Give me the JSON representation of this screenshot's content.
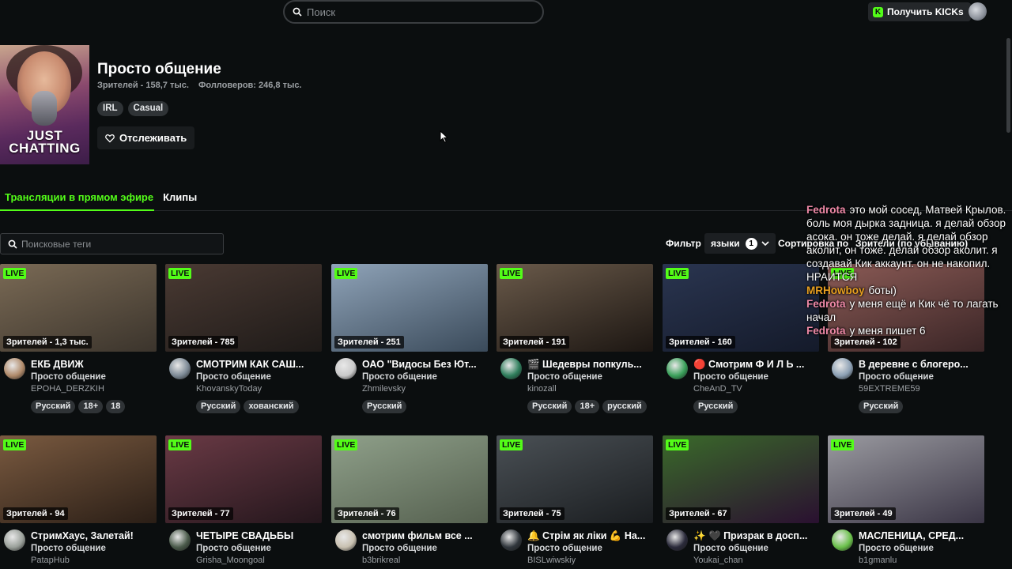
{
  "header": {
    "search_placeholder": "Поиск",
    "kicks_label": "Получить KICKs",
    "kicks_icon_glyph": "K",
    "accent": "#53fc18"
  },
  "category": {
    "cover_text": "JUST CHATTING",
    "title": "Просто общение",
    "viewers": "Зрителей - 158,7 тыс.",
    "followers": "Фолловеров: 246,8 тыс.",
    "tags": [
      "IRL",
      "Casual"
    ],
    "follow_label": "Отслеживать"
  },
  "tabs": {
    "live": "Трансляции в прямом эфире",
    "clips": "Клипы"
  },
  "filters": {
    "tag_search_placeholder": "Поисковые теги",
    "filter_label": "Фильтр",
    "language_label": "языки",
    "language_count": "1",
    "sort_label": "Сортировка по",
    "sort_value": "Зрители (по убыванию)"
  },
  "live_badge": "LIVE",
  "streams": [
    {
      "viewers": "Зрителей - 1,3 тыс.",
      "title": "ЕКБ ДВИЖ",
      "category": "Просто общение",
      "user": "EPOHA_DERZKIH",
      "tags": [
        "Русский",
        "18+",
        "18"
      ],
      "thumb": [
        "#7a6a55",
        "#3b342c"
      ],
      "avatar": "#b08a6a"
    },
    {
      "viewers": "Зрителей - 785",
      "title": "СМОТРИМ КАК САШ...",
      "category": "Просто общение",
      "user": "KhovanskyToday",
      "tags": [
        "Русский",
        "хованский"
      ],
      "thumb": [
        "#4a3a33",
        "#1e1a18"
      ],
      "avatar": "#7d8a96"
    },
    {
      "viewers": "Зрителей - 251",
      "title": "ОАО \"Видосы Без Ют...",
      "category": "Просто общение",
      "user": "Zhmilevsky",
      "tags": [
        "Русский"
      ],
      "thumb": [
        "#8fa3b8",
        "#3a4a5a"
      ],
      "avatar": "#c9c9c9"
    },
    {
      "viewers": "Зрителей - 191",
      "title": "🎬 Шедевры попкуль...",
      "category": "Просто общение",
      "user": "kinozall",
      "tags": [
        "Русский",
        "18+",
        "русский"
      ],
      "thumb": [
        "#6a5a4a",
        "#1c1612"
      ],
      "avatar": "#2e7d5b"
    },
    {
      "viewers": "Зрителей - 160",
      "title": "🔴 Смотрим Ф И Л Ь ...",
      "category": "Просто общение",
      "user": "CheAnD_TV",
      "tags": [
        "Русский"
      ],
      "thumb": [
        "#2a3550",
        "#141a2a"
      ],
      "avatar": "#3aa05a"
    },
    {
      "viewers": "Зрителей - 102",
      "title": "В деревне с блогеро...",
      "category": "Просто общение",
      "user": "59EXTREME59",
      "tags": [
        "Русский"
      ],
      "thumb": [
        "#8a5a55",
        "#3a2526"
      ],
      "avatar": "#8ca0b4"
    },
    {
      "viewers": "Зрителей - 94",
      "title": "СтримХаус, Залетай!",
      "category": "Просто общение",
      "user": "PatapHub",
      "tags": [],
      "thumb": [
        "#7a5a40",
        "#2a1e16"
      ],
      "avatar": "#9aa09a"
    },
    {
      "viewers": "Зрителей - 77",
      "title": "ЧЕТЫРЕ СВАДЬБЫ",
      "category": "Просто общение",
      "user": "Grisha_Moongoal",
      "tags": [],
      "thumb": [
        "#6a3a45",
        "#24161c"
      ],
      "avatar": "#4a5a4a"
    },
    {
      "viewers": "Зрителей - 76",
      "title": "смотрим фильм все ...",
      "category": "Просто общение",
      "user": "b3brikreal",
      "tags": [],
      "thumb": [
        "#8fa08a",
        "#55604f"
      ],
      "avatar": "#c8c0b0"
    },
    {
      "viewers": "Зрителей - 75",
      "title": "🔔 Стрім як ліки 💪 На...",
      "category": "Просто общение",
      "user": "BISLwiwskiy",
      "tags": [],
      "thumb": [
        "#4a5055",
        "#1a1d20"
      ],
      "avatar": "#30363c"
    },
    {
      "viewers": "Зрителей - 67",
      "title": "✨ 🖤 Призрак в досп...",
      "category": "Просто общение",
      "user": "Youkai_chan",
      "tags": [],
      "thumb": [
        "#3a6a2a",
        "#2a1030"
      ],
      "avatar": "#2a2a3a"
    },
    {
      "viewers": "Зрителей - 49",
      "title": "МАСЛЕНИЦА, СРЕД...",
      "category": "Просто общение",
      "user": "b1gmanlu",
      "tags": [],
      "thumb": [
        "#9a9aa0",
        "#3a3545"
      ],
      "avatar": "#6ac04a"
    }
  ],
  "chat": [
    {
      "name": "Fedrota",
      "color": "#f08aa8",
      "text": "это мой сосед, Матвей Крылов. боль моя дырка задница. я делай обзор асока. он тоже делай. я делай обзор аколит, он тоже. делай обзор аколит. я создавай Кик аккаунт. он не накопил. НРАИТСЯ"
    },
    {
      "name": "MRHowboy",
      "color": "#e8a020",
      "text": "боты)"
    },
    {
      "name": "Fedrota",
      "color": "#f08aa8",
      "text": "у меня ещё и Кик чё то лагать начал"
    },
    {
      "name": "Fedrota",
      "color": "#f08aa8",
      "text": "у меня пишет 6"
    }
  ]
}
